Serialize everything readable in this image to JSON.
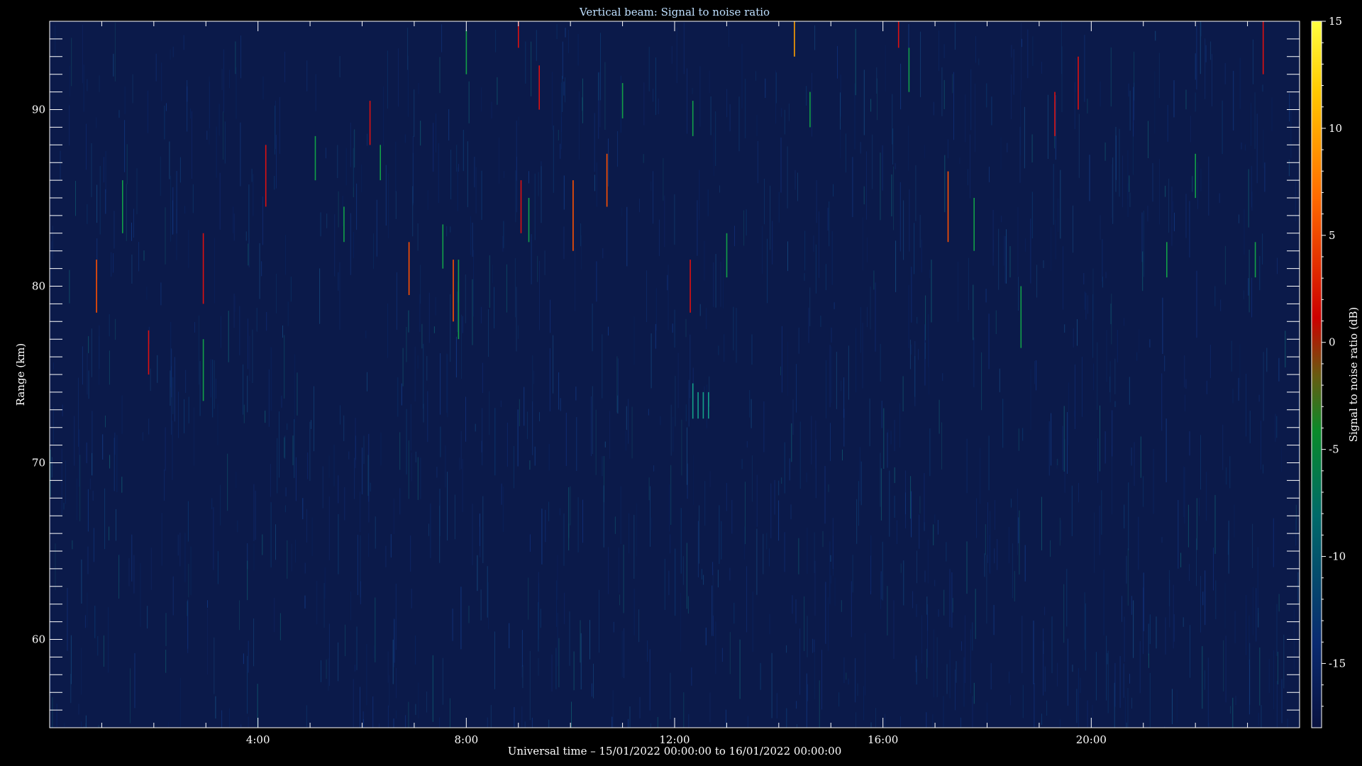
{
  "chart_data": {
    "type": "heatmap",
    "title": "Vertical beam: Signal to noise ratio",
    "xlabel": "Universal time – 15/01/2022 00:00:00 to 16/01/2022 00:00:00",
    "ylabel": "Range (km)",
    "colorbar_label": "Signal to noise ratio (dB)",
    "xlim": [
      0,
      24
    ],
    "ylim": [
      55,
      95
    ],
    "clim": [
      -18,
      15
    ],
    "x_ticks": [
      {
        "value": 4,
        "label": "4:00"
      },
      {
        "value": 8,
        "label": "8:00"
      },
      {
        "value": 12,
        "label": "12:00"
      },
      {
        "value": 16,
        "label": "16:00"
      },
      {
        "value": 20,
        "label": "20:00"
      }
    ],
    "y_ticks": [
      {
        "value": 60,
        "label": "60"
      },
      {
        "value": 70,
        "label": "70"
      },
      {
        "value": 80,
        "label": "80"
      },
      {
        "value": 90,
        "label": "90"
      }
    ],
    "colorbar_ticks": [
      {
        "value": 15,
        "label": "15"
      },
      {
        "value": 10,
        "label": "10"
      },
      {
        "value": 5,
        "label": "5"
      },
      {
        "value": 0,
        "label": "0"
      },
      {
        "value": -5,
        "label": "-5"
      },
      {
        "value": -10,
        "label": "-10"
      },
      {
        "value": -15,
        "label": "-15"
      }
    ],
    "background_snr": -16,
    "features": [
      {
        "x": 0.9,
        "y_from": 78.5,
        "y_to": 81.5,
        "snr": 3
      },
      {
        "x": 1.4,
        "y_from": 83,
        "y_to": 86,
        "snr": -6
      },
      {
        "x": 1.9,
        "y_from": 75,
        "y_to": 77.5,
        "snr": 0
      },
      {
        "x": 2.95,
        "y_from": 73.5,
        "y_to": 77,
        "snr": -6
      },
      {
        "x": 2.95,
        "y_from": 79,
        "y_to": 83,
        "snr": 0
      },
      {
        "x": 4.15,
        "y_from": 84.5,
        "y_to": 88,
        "snr": 2
      },
      {
        "x": 5.1,
        "y_from": 86,
        "y_to": 88.5,
        "snr": -6
      },
      {
        "x": 5.65,
        "y_from": 82.5,
        "y_to": 84.5,
        "snr": -5
      },
      {
        "x": 6.15,
        "y_from": 88,
        "y_to": 90.5,
        "snr": 0
      },
      {
        "x": 6.35,
        "y_from": 86,
        "y_to": 88,
        "snr": -6
      },
      {
        "x": 6.9,
        "y_from": 79.5,
        "y_to": 82.5,
        "snr": 4
      },
      {
        "x": 7.55,
        "y_from": 81,
        "y_to": 83.5,
        "snr": -6
      },
      {
        "x": 7.75,
        "y_from": 78,
        "y_to": 81.5,
        "snr": 4
      },
      {
        "x": 7.85,
        "y_from": 77,
        "y_to": 81.5,
        "snr": -6
      },
      {
        "x": 8.0,
        "y_from": 92,
        "y_to": 94.5,
        "snr": -6
      },
      {
        "x": 9.0,
        "y_from": 93.5,
        "y_to": 95,
        "snr": 1
      },
      {
        "x": 9.05,
        "y_from": 83,
        "y_to": 86,
        "snr": 0
      },
      {
        "x": 9.2,
        "y_from": 82.5,
        "y_to": 85,
        "snr": -6
      },
      {
        "x": 9.4,
        "y_from": 90,
        "y_to": 92.5,
        "snr": 0
      },
      {
        "x": 10.05,
        "y_from": 82,
        "y_to": 86,
        "snr": 6
      },
      {
        "x": 10.7,
        "y_from": 84.5,
        "y_to": 87.5,
        "snr": 6
      },
      {
        "x": 11.0,
        "y_from": 89.5,
        "y_to": 91.5,
        "snr": -6
      },
      {
        "x": 12.3,
        "y_from": 78.5,
        "y_to": 81.5,
        "snr": 0
      },
      {
        "x": 12.35,
        "y_from": 88.5,
        "y_to": 90.5,
        "snr": -6
      },
      {
        "x": 12.35,
        "y_from": 72.5,
        "y_to": 74.5,
        "snr": -8
      },
      {
        "x": 12.45,
        "y_from": 72.5,
        "y_to": 74,
        "snr": -8
      },
      {
        "x": 12.55,
        "y_from": 72.5,
        "y_to": 74,
        "snr": -8
      },
      {
        "x": 12.65,
        "y_from": 72.5,
        "y_to": 74,
        "snr": -8
      },
      {
        "x": 13.0,
        "y_from": 80.5,
        "y_to": 83,
        "snr": -6
      },
      {
        "x": 14.3,
        "y_from": 93,
        "y_to": 95,
        "snr": 8
      },
      {
        "x": 14.6,
        "y_from": 89,
        "y_to": 91,
        "snr": -6
      },
      {
        "x": 16.3,
        "y_from": 93.5,
        "y_to": 95,
        "snr": 0
      },
      {
        "x": 16.5,
        "y_from": 91,
        "y_to": 93.5,
        "snr": -6
      },
      {
        "x": 17.25,
        "y_from": 82.5,
        "y_to": 86.5,
        "snr": 5
      },
      {
        "x": 17.75,
        "y_from": 82,
        "y_to": 85,
        "snr": -6
      },
      {
        "x": 18.65,
        "y_from": 76.5,
        "y_to": 80,
        "snr": -6
      },
      {
        "x": 19.3,
        "y_from": 88.5,
        "y_to": 91,
        "snr": 0
      },
      {
        "x": 19.75,
        "y_from": 90,
        "y_to": 93,
        "snr": 0
      },
      {
        "x": 21.45,
        "y_from": 80.5,
        "y_to": 82.5,
        "snr": -6
      },
      {
        "x": 22.0,
        "y_from": 85,
        "y_to": 87.5,
        "snr": -6
      },
      {
        "x": 23.15,
        "y_from": 80.5,
        "y_to": 82.5,
        "snr": -6
      },
      {
        "x": 23.3,
        "y_from": 92,
        "y_to": 95,
        "snr": 0
      }
    ]
  },
  "colors": {
    "background": "#000000",
    "plot_background": "#0b1a4a",
    "axis": "#ffffff",
    "title": "#bfe0ff",
    "colormap": [
      "#0a1240",
      "#0a2a70",
      "#006a6a",
      "#0a8a2a",
      "#7a4a00",
      "#cc0000",
      "#ff6a00",
      "#ffd000",
      "#ffff40"
    ]
  }
}
